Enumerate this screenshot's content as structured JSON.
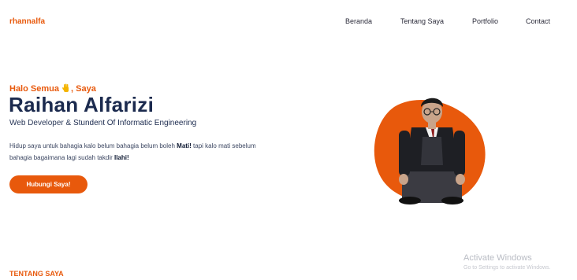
{
  "header": {
    "brand": "rhannalfa",
    "nav": [
      "Beranda",
      "Tentang Saya",
      "Portfolio",
      "Contact"
    ]
  },
  "hero": {
    "greeting_before": "Halo Semua ",
    "greeting_after": ", Saya",
    "name": "Raihan Alfarizi",
    "role_part1": "Web Developer & ",
    "role_part2": "Stundent Of Informatic Engineering",
    "para_part1": "Hidup saya untuk bahagia kalo belum bahagia belum boleh ",
    "para_bold1": "Mati!",
    "para_part2": " tapi kalo mati sebelum bahagia bagaimana lagi sudah takdir ",
    "para_bold2": "Ilahi!",
    "cta_label": "Hubungi Saya!"
  },
  "section": {
    "title": "TENTANG SAYA"
  },
  "watermark": {
    "title": "Activate Windows",
    "subtitle": "Go to Settings to activate Windows."
  },
  "colors": {
    "accent": "#e8590c",
    "heading": "#1b2a4e"
  },
  "icons": {
    "greeting": "waving-hand-icon"
  }
}
